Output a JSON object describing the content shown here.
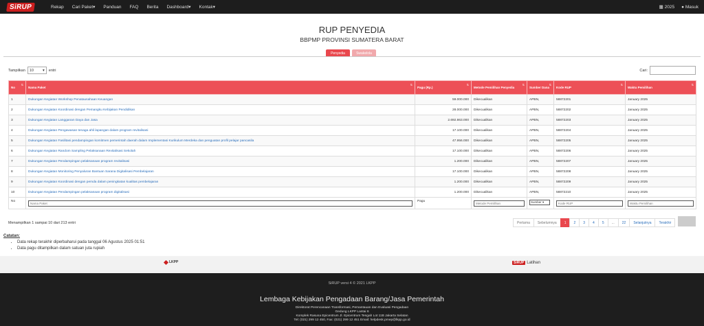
{
  "nav": {
    "brand": "SiRUP",
    "items": [
      "Rekap",
      "Cari Paket▾",
      "Panduan",
      "FAQ",
      "Berita",
      "Dashboard▾",
      "Kontak▾"
    ],
    "year": "2025",
    "login": "Masuk"
  },
  "header": {
    "title": "RUP PENYEDIA",
    "subtitle": "BBPMP PROVINSI SUMATERA BARAT"
  },
  "tabs": [
    {
      "label": "Penyedia",
      "active": true
    },
    {
      "label": "Swakelola",
      "active": false
    }
  ],
  "controls": {
    "show_label": "Tampilkan",
    "show_value": "10",
    "entries_label": "entri",
    "search_label": "Cari:"
  },
  "table": {
    "columns": [
      "No",
      "Nama Paket",
      "Pagu (Rp.)",
      "Metode Pemilihan Penyedia",
      "Sumber Dana",
      "Kode RUP",
      "Waktu Pemilihan"
    ],
    "rows": [
      [
        "1",
        "Dukungan Kegiatan Workshop Penatausahaan Keuangan",
        "59.000.000",
        "Dikecualikan",
        "APBN,",
        "58872201",
        "January 2025"
      ],
      [
        "2",
        "Dukungan Kegiatan Koordinasi dengan Pemangku Kebijakan Pendidikan",
        "28.000.000",
        "Dikecualikan",
        "APBN,",
        "58872202",
        "January 2025"
      ],
      [
        "3",
        "Dukungan Kegiatan Langganan Daya dan Jasa",
        "2.692.863.000",
        "Dikecualikan",
        "APBN,",
        "58872203",
        "January 2025"
      ],
      [
        "4",
        "Dukungan Kegiatan Pengawasan tenaga ahli lapangan dalam program revitalisasi",
        "17.100.000",
        "Dikecualikan",
        "APBN,",
        "58872204",
        "January 2025"
      ],
      [
        "5",
        "Dukungan Kegiatan Fasilitasi pendampingan komitmen pemerintah daerah dalam Implementasi Kurikulum Merdeka dan penguatan profil pelajar pancasila",
        "47.956.000",
        "Dikecualikan",
        "APBN,",
        "58872205",
        "January 2025"
      ],
      [
        "6",
        "Dukungan Kegiatan Random Sampling Pelaksanaan Revitalisasi Sekolah",
        "17.100.000",
        "Dikecualikan",
        "APBN,",
        "58872206",
        "January 2025"
      ],
      [
        "7",
        "Dukungan Kegiatan Pendampingan pelaksanaan program revitalisasi",
        "1.200.000",
        "Dikecualikan",
        "APBN,",
        "58872207",
        "January 2025"
      ],
      [
        "8",
        "Dukungan Kegiatan Monitoring Penyaluran Bantuan Sarana Digitalisasi Pembelajaran",
        "17.100.000",
        "Dikecualikan",
        "APBN,",
        "58872208",
        "January 2025"
      ],
      [
        "9",
        "Dukungan Kegiatan Koordinasi dengan pemda dalam peningkatan kualitas pembelajaran",
        "1.200.000",
        "Dikecualikan",
        "APBN,",
        "58872209",
        "January 2025"
      ],
      [
        "10",
        "Dukungan Kegiatan Pendampingan pelaksanaan program digitalisasi",
        "1.200.000",
        "Dikecualikan",
        "APBN,",
        "58872210",
        "January 2025"
      ]
    ],
    "footer": {
      "no": "No",
      "nama_placeholder": "Nama Paket",
      "pagu": "Pagu",
      "metode_placeholder": "Metode Pemilihan",
      "sumber_value": "Sumber",
      "kode_placeholder": "Kode RUP",
      "waktu_placeholder": "Waktu Pemilihan"
    }
  },
  "info": "Menampilkan 1 sampai 10 dari 213 entri",
  "pagination": [
    "Pertama",
    "Sebelumnya",
    "1",
    "2",
    "3",
    "4",
    "5",
    "...",
    "22",
    "Selanjutnya",
    "Terakhir"
  ],
  "notes": {
    "title": "Catatan:",
    "items": [
      "Data rekap terakhir diperbaharui pada tanggal 06 Agustus 2025 01:51",
      "Data pagu ditampilkan dalam satuan juta rupiah"
    ]
  },
  "footer": {
    "lkpp_logo": "LKPP",
    "sirup_logo": "SiRUP",
    "latihan": "Latihan",
    "version": "SiRUP versi 4 © 2021 LKPP",
    "org": "Lembaga Kebijakan Pengadaan Barang/Jasa Pemerintah",
    "lines": [
      "Direktorat Perencanaan Transformasi, Pemantauan dan Evaluasi Pengadaan",
      "Gedung LKPP Lantai 6",
      "Komplek Rasuna Epicentrum Jl. Epicentrum Tengah Lot 11B Jakarta Selatan",
      "Tel: (021) 299 12 450, Fax: (021) 299 12 451 Email: helpdesk.pmep@lkpp.go.id"
    ]
  },
  "colors": {
    "accent": "#e9474d",
    "nav_bg": "#1d1d1d",
    "link": "#2a6ebb"
  }
}
